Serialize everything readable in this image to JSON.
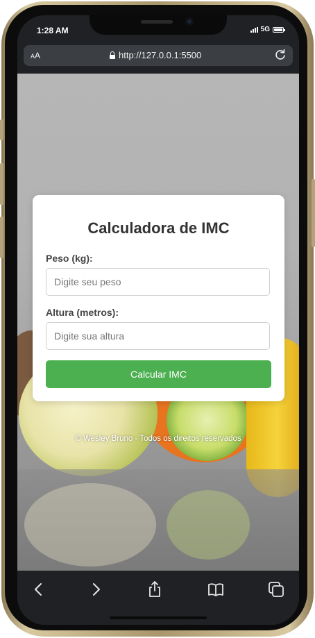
{
  "status_bar": {
    "time": "1:28 AM",
    "network": "5G"
  },
  "browser": {
    "aa_label_small": "A",
    "aa_label_large": "A",
    "url": "http://127.0.0.1:5500"
  },
  "form": {
    "title": "Calculadora de IMC",
    "weight": {
      "label": "Peso (kg):",
      "placeholder": "Digite seu peso",
      "value": ""
    },
    "height": {
      "label": "Altura (metros):",
      "placeholder": "Digite sua altura",
      "value": ""
    },
    "submit_label": "Calcular IMC"
  },
  "footer": {
    "text": "© Wesley Bruno - Todos os direitos reservados"
  },
  "colors": {
    "accent": "#4caf50",
    "card_bg": "#ffffff",
    "browser_chrome": "#1f2124"
  },
  "toolbar": {
    "icons": [
      "back-icon",
      "forward-icon",
      "share-icon",
      "bookmarks-icon",
      "tabs-icon"
    ]
  }
}
